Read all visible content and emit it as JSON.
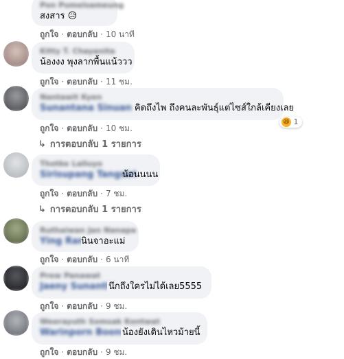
{
  "comments": [
    {
      "text_visible": "สงสาร",
      "emoji": "😥",
      "like": "ถูกใจ",
      "reply": "ตอบกลับ",
      "time": "10 นาที",
      "avatar_color": "#8a7b72"
    },
    {
      "name": "Kitty T. Chayanita",
      "text_visible": "น้องงง พุงลากพื้นแน้ววว",
      "like": "ถูกใจ",
      "reply": "ตอบกลับ",
      "time": "11 ชม.",
      "avatar_color": "#a58e8a"
    },
    {
      "name": "Nantawit Kyen",
      "mention": "Sunantana Sinuan",
      "text_visible": "คิดถึงไพ ถึงคนละพันธุ์แต่ไซส์ใกล้เคียงเลย",
      "like": "ถูกใจ",
      "reply": "ตอบกลับ",
      "time": "10 ชม.",
      "reaction_count": "1",
      "replies_label": "การตอบกลับ 1 รายการ",
      "avatar_color": "#5c5e61"
    },
    {
      "name": "Thotke Lalluyo",
      "mention": "Sirisupang Tangsiri",
      "text_visible": "น้อนนนน",
      "like": "ถูกใจ",
      "reply": "ตอบกลับ",
      "time": "7 ชม.",
      "replies_label": "การตอบกลับ 1 รายการ",
      "avatar_color": "#b9bdc2"
    },
    {
      "name": "Ruthaiwan Jan Nanapa",
      "mention": "Ying Rana",
      "text_visible": "นินจาอะแม่",
      "like": "ถูกใจ",
      "reply": "ตอบกลับ",
      "time": "6 นาที",
      "avatar_color": "#6f7a5a"
    },
    {
      "name": "Prew Panawat",
      "mention": "Jaeny Sunanthia",
      "text_visible": "นึกถึงใครไม่ได้เลย5555",
      "like": "ถูกใจ",
      "reply": "ตอบกลับ",
      "time": "9 ชม.",
      "avatar_color": "#2f3136"
    },
    {
      "name": "Weerayuth Somsak Kontwat",
      "mention": "Warinporn Boonsak",
      "text_visible": "น้องยังเดินไหวม้ายนี้",
      "like": "ถูกใจ",
      "reply": "ตอบกลับ",
      "time": "9 ชม.",
      "avatar_color": "#7d8087"
    }
  ]
}
